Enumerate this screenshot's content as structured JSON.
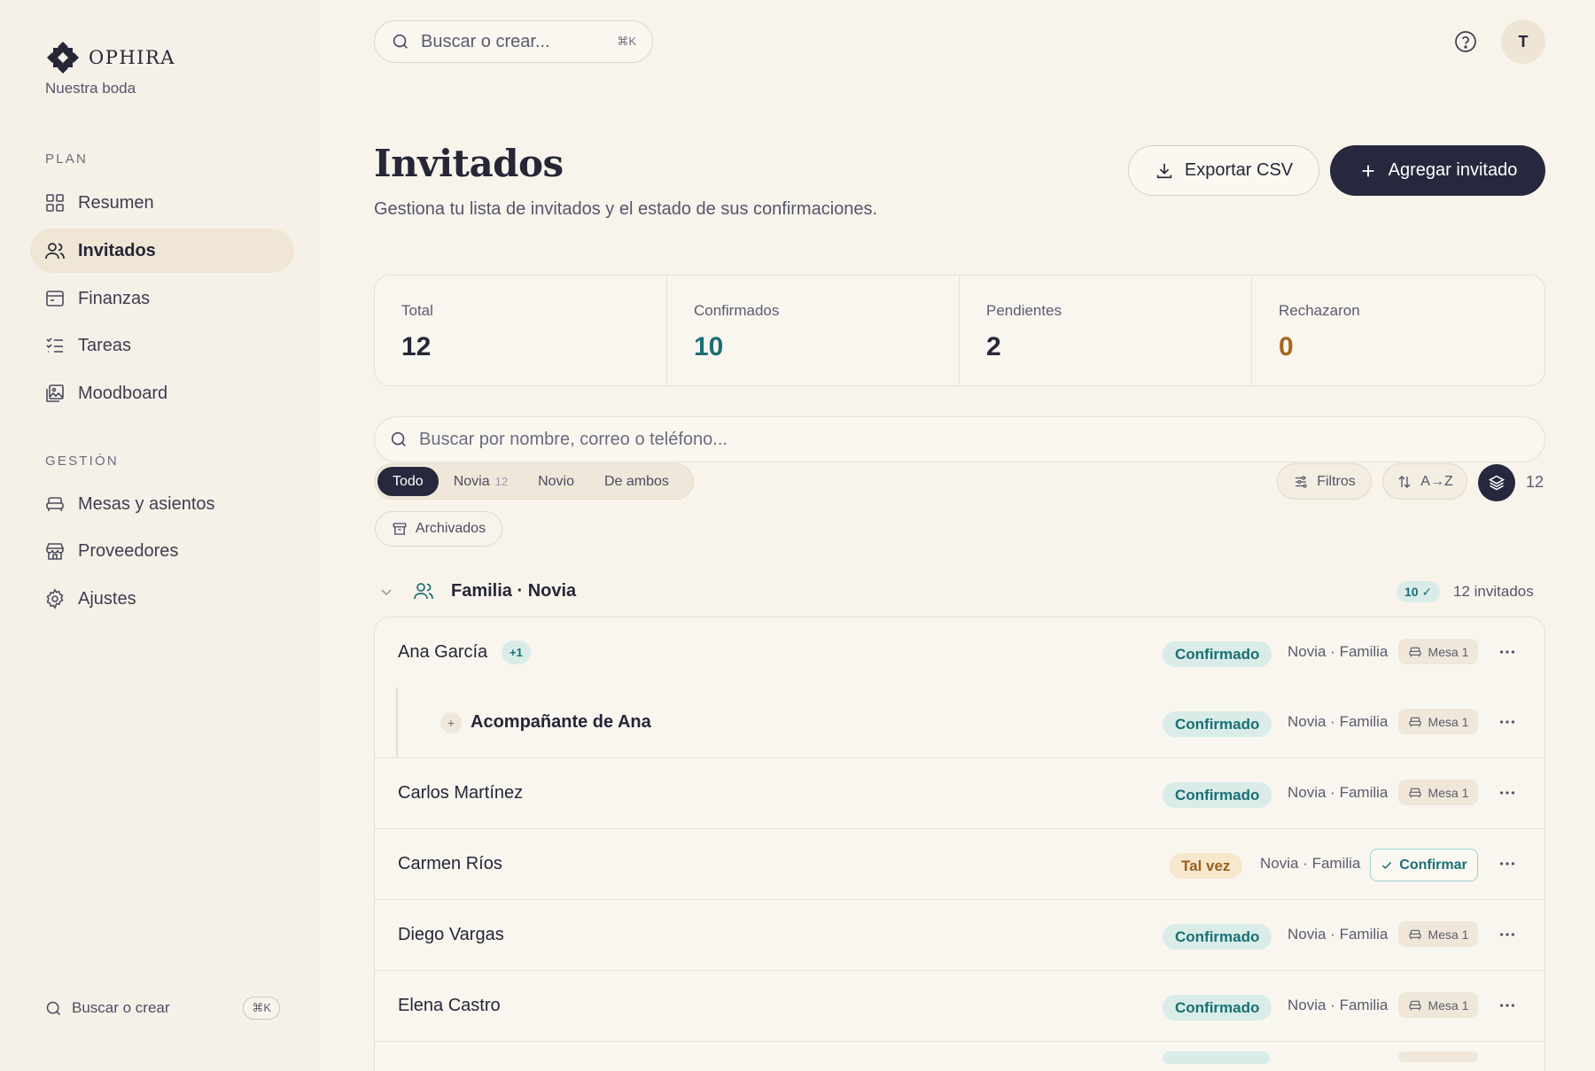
{
  "brand": {
    "name": "OPHIRA",
    "subtitle": "Nuestra boda"
  },
  "sidebar": {
    "plan_label": "PLAN",
    "plan_items": [
      {
        "label": "Resumen",
        "icon": "grid-icon"
      },
      {
        "label": "Invitados",
        "icon": "users-icon",
        "active": true
      },
      {
        "label": "Finanzas",
        "icon": "wallet-icon"
      },
      {
        "label": "Tareas",
        "icon": "checklist-icon"
      },
      {
        "label": "Moodboard",
        "icon": "image-icon"
      }
    ],
    "gestion_label": "GESTIÓN",
    "gestion_items": [
      {
        "label": "Mesas y asientos",
        "icon": "sofa-icon"
      },
      {
        "label": "Proveedores",
        "icon": "store-icon"
      },
      {
        "label": "Ajustes",
        "icon": "gear-icon"
      }
    ],
    "search_label": "Buscar o crear",
    "search_shortcut": "⌘K"
  },
  "topbar": {
    "search_placeholder": "Buscar o crear...",
    "search_shortcut": "⌘K",
    "avatar_initial": "T"
  },
  "header": {
    "title": "Invitados",
    "subtitle": "Gestiona tu lista de invitados y el estado de sus confirmaciones.",
    "export_label": "Exportar CSV",
    "add_label": "Agregar invitado"
  },
  "stats": [
    {
      "label": "Total",
      "value": "12",
      "color": "#262637"
    },
    {
      "label": "Confirmados",
      "value": "10",
      "color": "#1a6f74"
    },
    {
      "label": "Pendientes",
      "value": "2",
      "color": "#262637"
    },
    {
      "label": "Rechazaron",
      "value": "0",
      "color": "#a8651f"
    }
  ],
  "filters": {
    "search_placeholder": "Buscar por nombre, correo o teléfono...",
    "segments": [
      {
        "label": "Todo",
        "active": true
      },
      {
        "label": "Novia",
        "count": "12"
      },
      {
        "label": "Novio"
      },
      {
        "label": "De ambos"
      }
    ],
    "filters_label": "Filtros",
    "sort_label": "A→Z",
    "total": "12",
    "archived_label": "Archivados"
  },
  "group": {
    "title": "Familia · Novia",
    "badge": "10 ✓",
    "count_label": "12 invitados"
  },
  "guests": [
    {
      "name": "Ana García",
      "plus": "+1",
      "status": "Confirmado",
      "meta": "Novia · Familia",
      "table": "Mesa 1"
    },
    {
      "name": "Acompañante de Ana",
      "sub_marker": "+",
      "status": "Confirmado",
      "meta": "Novia · Familia",
      "table": "Mesa 1"
    },
    {
      "name": "Carlos Martínez",
      "status": "Confirmado",
      "meta": "Novia · Familia",
      "table": "Mesa 1"
    },
    {
      "name": "Carmen Ríos",
      "status": "Tal vez",
      "meta": "Novia · Familia",
      "action": "Confirmar"
    },
    {
      "name": "Diego Vargas",
      "status": "Confirmado",
      "meta": "Novia · Familia",
      "table": "Mesa 1"
    },
    {
      "name": "Elena Castro",
      "status": "Confirmado",
      "meta": "Novia · Familia",
      "table": "Mesa 1"
    }
  ]
}
